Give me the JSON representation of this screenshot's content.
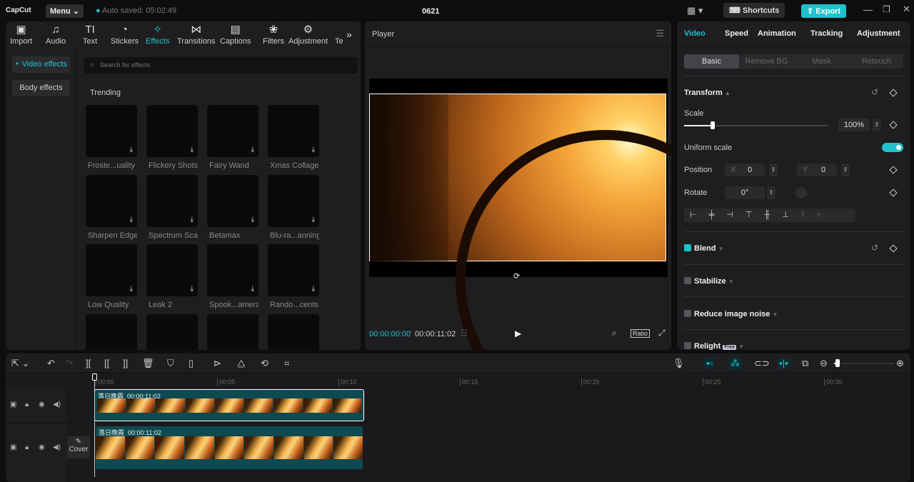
{
  "app": {
    "logo": "CapCut",
    "menu": "Menu",
    "autosave": "Auto saved: 05:02:49",
    "project_title": "0621",
    "shortcuts": "Shortcuts",
    "export": "Export",
    "accent": "#1fc1cc"
  },
  "media_tabs": [
    {
      "label": "Import",
      "icon": "▣"
    },
    {
      "label": "Audio",
      "icon": "♫"
    },
    {
      "label": "Text",
      "icon": "TI"
    },
    {
      "label": "Stickers",
      "icon": "◔"
    },
    {
      "label": "Effects",
      "icon": "✧"
    },
    {
      "label": "Transitions",
      "icon": "⋈"
    },
    {
      "label": "Captions",
      "icon": "▤"
    },
    {
      "label": "Filters",
      "icon": "❀"
    },
    {
      "label": "Adjustment",
      "icon": "⚙"
    },
    {
      "label": "Te",
      "icon": ""
    }
  ],
  "effects_sidebar": [
    "Video effects",
    "Body effects"
  ],
  "search_placeholder": "Search for effects",
  "section": "Trending",
  "effects": [
    "Froste...uality",
    "Flickery Shots",
    "Fairy Wand",
    "Xmas Collage",
    "Sharpen Edges",
    "Spectrum Scan",
    "Betamax",
    "Blu-ra...anning",
    "Low Quality",
    "Leak 2",
    "Spook...amera",
    "Rando...cents",
    "",
    "",
    "",
    ""
  ],
  "player": {
    "title": "Player",
    "current_time": "00:00:00:00",
    "total_time": "00:00:11:02",
    "ratio": "Ratio"
  },
  "right": {
    "tabs": [
      "Video",
      "Speed",
      "Animation",
      "Tracking",
      "Adjustment"
    ],
    "subtabs": [
      "Basic",
      "Remove BG",
      "Mask",
      "Retouch"
    ],
    "transform": "Transform",
    "scale_label": "Scale",
    "scale_value": "100%",
    "scale_fraction": 0.2,
    "uniform_scale": "Uniform scale",
    "uniform_on": true,
    "position": "Position",
    "x_label": "X",
    "x_value": "0",
    "y_label": "Y",
    "y_value": "0",
    "rotate": "Rotate",
    "rotate_value": "0°",
    "blend": "Blend",
    "stabilize": "Stabilize",
    "reduce_noise": "Reduce image noise",
    "relight": "Relight",
    "relight_badge": "Free"
  },
  "timeline": {
    "ruler": [
      "00:00",
      "00:05",
      "00:10",
      "00:15",
      "00:20",
      "00:25",
      "00:30"
    ],
    "clips": [
      {
        "name": "落日晚霞",
        "duration": "00:00:11:02"
      },
      {
        "name": "落日晚霞",
        "duration": "00:00:11:02"
      }
    ],
    "cover": "Cover"
  }
}
